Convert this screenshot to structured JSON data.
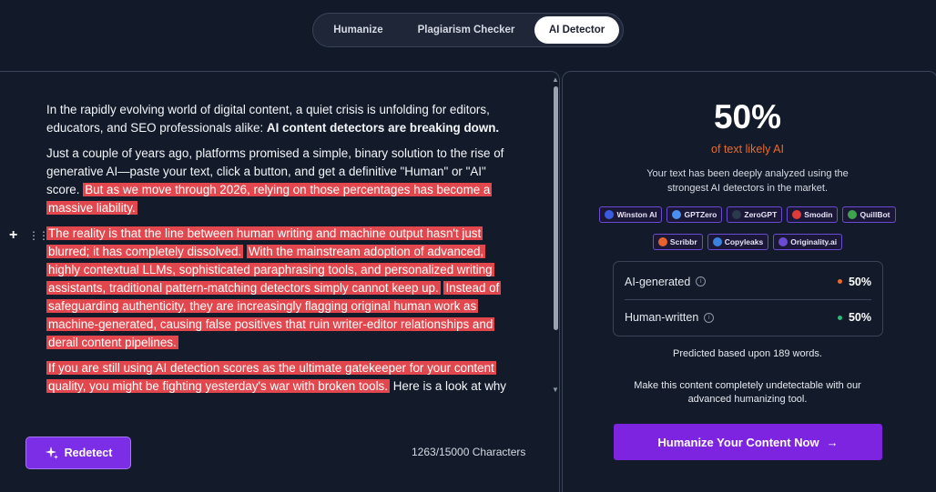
{
  "tabs": [
    {
      "label": "Humanize"
    },
    {
      "label": "Plagiarism Checker"
    },
    {
      "label": "AI Detector"
    }
  ],
  "editor": {
    "p1_plain": "In the rapidly evolving world of digital content, a quiet crisis is unfolding for editors, educators, and SEO professionals alike: ",
    "p1_bold": "AI content detectors are breaking down.",
    "p2_plain": "Just a couple of years ago, platforms promised a simple, binary solution to the rise of generative AI—paste your text, click a button, and get a definitive \"Human\" or \"AI\" score. ",
    "p2_hl": "But as we move through 2026, relying on those percentages has become a massive liability.",
    "p3_hl1": "The reality is that the line between human writing and machine output hasn't just blurred; it has completely dissolved.",
    "p3_hl2": "With the mainstream adoption of advanced, highly contextual LLMs, sophisticated paraphrasing tools, and personalized writing assistants, traditional pattern-matching detectors simply cannot keep up.",
    "p3_hl3": "Instead of safeguarding authenticity, they are increasingly flagging original human work as machine-generated, causing false positives that ruin writer-editor relationships and derail content pipelines.",
    "p4_hl": "If you are still using AI detection scores as the ultimate gatekeeper for your content quality, you might be fighting yesterday's war with broken tools.",
    "p4_plain": "Here is a look at why",
    "add_glyph": "+",
    "drag_glyph": "⋮⋮",
    "redetect_label": "Redetect",
    "char_count": "1263/15000 Characters"
  },
  "results": {
    "percent": "50%",
    "likely_label": "of text likely AI",
    "description": "Your text has been deeply analyzed using the strongest AI detectors in the market.",
    "detectors": [
      {
        "name": "Winston AI",
        "color": "#3d5be0",
        "letter": "W"
      },
      {
        "name": "GPTZero",
        "color": "#4a8ff0",
        "letter": "G"
      },
      {
        "name": "ZeroGPT",
        "color": "#2a3a4a",
        "letter": "Z"
      },
      {
        "name": "Smodin",
        "color": "#e03b3b",
        "letter": "S"
      },
      {
        "name": "QuillBot",
        "color": "#3fa34d",
        "letter": "Q"
      },
      {
        "name": "Scribbr",
        "color": "#e8622c",
        "letter": "S"
      },
      {
        "name": "Copyleaks",
        "color": "#3b82e0",
        "letter": "C"
      },
      {
        "name": "Originality.ai",
        "color": "#6b4bd1",
        "letter": "O"
      }
    ],
    "ai_label": "AI-generated",
    "ai_value": "50%",
    "ai_color": "#ea6a2b",
    "human_label": "Human-written",
    "human_value": "50%",
    "human_color": "#2fb87a",
    "info_glyph": "i",
    "predicted": "Predicted based upon 189 words.",
    "make_text": "Make this content completely undetectable with our advanced humanizing tool.",
    "cta_label": "Humanize Your Content Now",
    "cta_arrow": "→"
  },
  "colors": {
    "background": "#121a29",
    "highlight": "#e2474d",
    "accent": "#7c24e0"
  }
}
